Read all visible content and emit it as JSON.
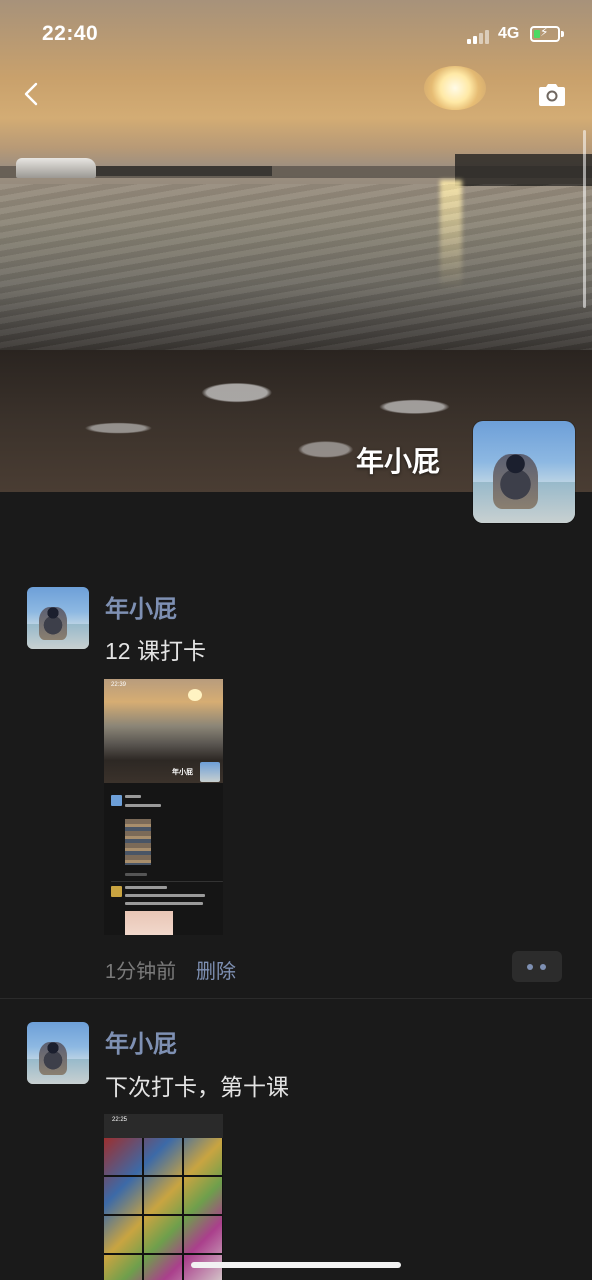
{
  "status_bar": {
    "time": "22:40",
    "network": "4G",
    "battery_level": 0.25,
    "battery_color": "#4cd964"
  },
  "header": {
    "back_icon": "chevron-left-icon",
    "camera_icon": "camera-icon"
  },
  "profile": {
    "name": "年小屁"
  },
  "posts": [
    {
      "author": "年小屁",
      "text": "12 课打卡",
      "image_time": "22:39",
      "image_name": "年小屁",
      "time": "1分钟前",
      "delete_label": "删除"
    },
    {
      "author": "年小屁",
      "text": "下次打卡，第十课",
      "image_time": "22:25"
    }
  ],
  "colors": {
    "background": "#1a1a1a",
    "author": "#7e90b3",
    "body_text": "#e4e4e4",
    "muted": "#7a7a7a"
  }
}
